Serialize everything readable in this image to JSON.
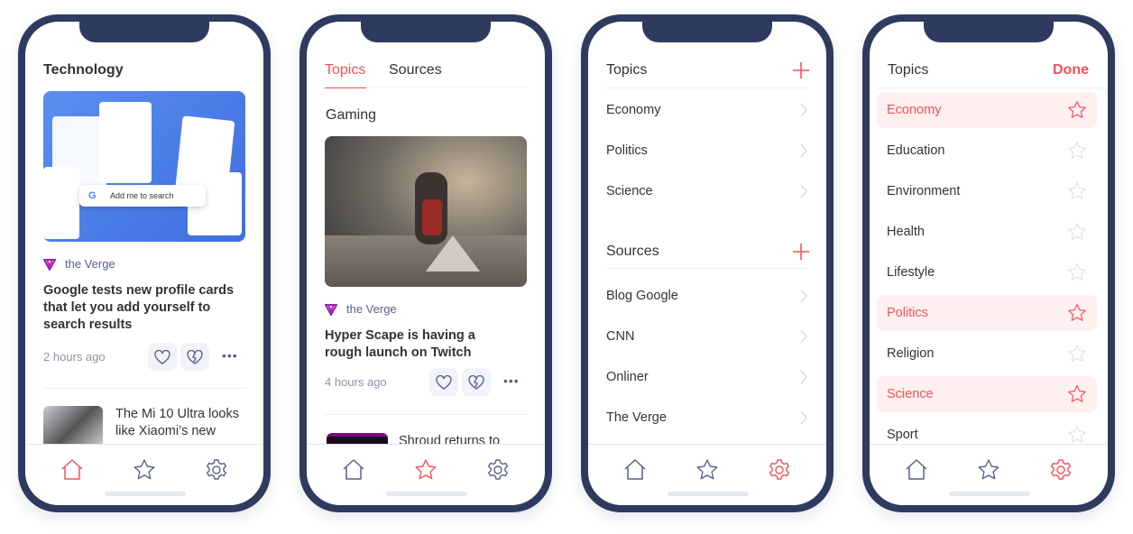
{
  "colors": {
    "frame": "#2f3b5e",
    "accent": "#f7505a",
    "muted": "#8a93a8",
    "highlight": "#fff0f0"
  },
  "phone1": {
    "heading": "Technology",
    "image_caption": "Add me to search",
    "source": "the Verge",
    "title": "Google tests new profile cards that let you add yourself to search results",
    "time": "2 hours ago",
    "next_title": "The Mi 10 Ultra looks like Xiaomi’s new",
    "active_tab": "home"
  },
  "phone2": {
    "tabs": [
      "Topics",
      "Sources"
    ],
    "active_tab_index": 0,
    "heading": "Gaming",
    "source": "the Verge",
    "title": "Hyper Scape is having a rough launch on Twitch",
    "time": "4 hours ago",
    "next_title": "Shroud returns to",
    "active_tab": "favorites"
  },
  "phone3": {
    "topics_heading": "Topics",
    "topics": [
      "Economy",
      "Politics",
      "Science"
    ],
    "sources_heading": "Sources",
    "sources": [
      "Blog Google",
      "CNN",
      "Onliner",
      "The Verge"
    ],
    "active_tab": "settings"
  },
  "phone4": {
    "heading": "Topics",
    "done_label": "Done",
    "topics": [
      {
        "label": "Economy",
        "selected": true
      },
      {
        "label": "Education",
        "selected": false
      },
      {
        "label": "Environment",
        "selected": false
      },
      {
        "label": "Health",
        "selected": false
      },
      {
        "label": "Lifestyle",
        "selected": false
      },
      {
        "label": "Politics",
        "selected": true
      },
      {
        "label": "Religion",
        "selected": false
      },
      {
        "label": "Science",
        "selected": true
      },
      {
        "label": "Sport",
        "selected": false
      }
    ],
    "active_tab": "settings"
  }
}
